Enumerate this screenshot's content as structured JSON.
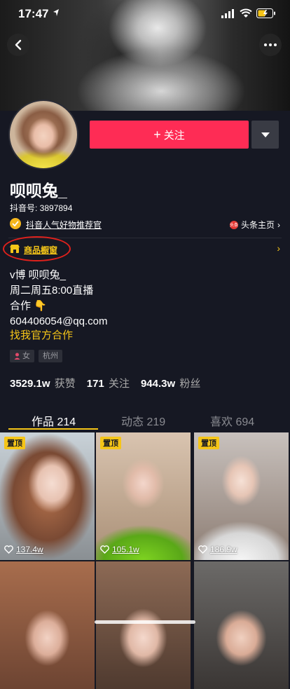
{
  "status_bar": {
    "time": "17:47"
  },
  "profile": {
    "follow_label": "关注",
    "follow_plus": "+",
    "name": "呗呗兔_",
    "douyin_id": "抖音号: 3897894",
    "cert_text": "抖音人气好物推荐官",
    "toutiao_label": "头条主页",
    "toutiao_chevron": "›",
    "toutiao_icon_text": "头条",
    "shop_label": "商品橱窗",
    "shop_chevron": "›",
    "bio": [
      "v博 呗呗兔_",
      "周二周五8:00直播",
      "合作 👇",
      "604406054@qq.com"
    ],
    "partner_link": "找我官方合作",
    "tags": [
      {
        "icon": "female-icon",
        "label": "女"
      },
      {
        "label": "杭州"
      }
    ],
    "stats": [
      {
        "value": "3529.1w",
        "label": "获赞"
      },
      {
        "value": "171",
        "label": "关注"
      },
      {
        "value": "944.3w",
        "label": "粉丝"
      }
    ]
  },
  "tabs": [
    {
      "label": "作品 214",
      "active": true
    },
    {
      "label": "动态 219",
      "active": false
    },
    {
      "label": "喜欢 694",
      "active": false
    }
  ],
  "videos": [
    {
      "pinned": "置顶",
      "likes": "137.4w"
    },
    {
      "pinned": "置顶",
      "likes": "105.1w"
    },
    {
      "pinned": "置顶",
      "likes": "186.9w"
    },
    {
      "pinned": "",
      "likes": ""
    },
    {
      "pinned": "",
      "likes": ""
    },
    {
      "pinned": "",
      "likes": ""
    }
  ],
  "colors": {
    "accent": "#fe2c55",
    "highlight": "#f5c518",
    "background": "#161823"
  }
}
